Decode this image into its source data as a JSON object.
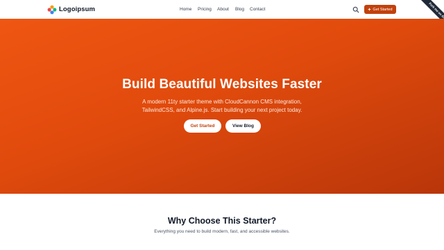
{
  "brand": {
    "name": "Logoipsum"
  },
  "nav": {
    "links": [
      "Home",
      "Pricing",
      "About",
      "Blog",
      "Contact"
    ],
    "search_icon": "search-icon",
    "cta_label": "Get Started",
    "cta_icon": "sparkle-icon",
    "accent_color": "#c2410c"
  },
  "ribbon": {
    "text": "Fork me on GitHub"
  },
  "hero": {
    "title": "Build Beautiful Websites Faster",
    "subtitle_line1": "A modern 11ty starter theme with CloudCannon CMS integration,",
    "subtitle_line2": "TailwindCSS, and Alpine.js. Start building your next project today.",
    "primary_button": "Get Started",
    "secondary_button": "View Blog",
    "gradient_start": "#ef5613",
    "gradient_end": "#b9360a"
  },
  "features": {
    "title": "Why Choose This Starter?",
    "subtitle": "Everything you need to build modern, fast, and accessible websites."
  }
}
